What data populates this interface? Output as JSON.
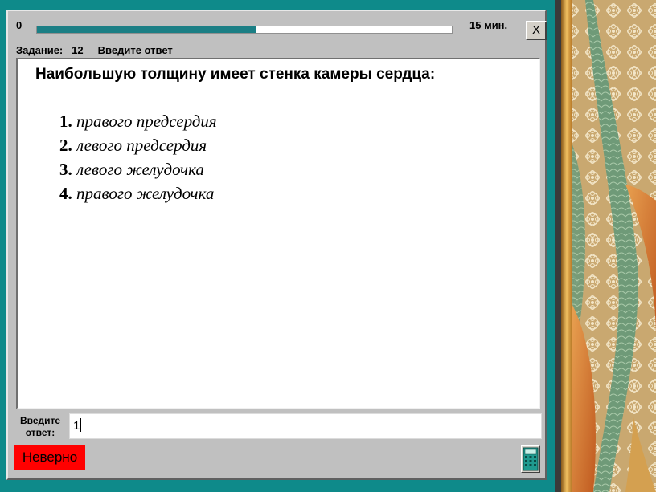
{
  "progress": {
    "start_label": "0",
    "fraction": 0.53
  },
  "timer": {
    "label": "15 мин."
  },
  "close_button": {
    "label": "X"
  },
  "task": {
    "label": "Задание:",
    "number": "12",
    "instruction": "Введите ответ"
  },
  "question": {
    "text": "Наибольшую толщину имеет стенка камеры сердца:",
    "options": [
      {
        "num": "1.",
        "text": "правого предсердия"
      },
      {
        "num": "2.",
        "text": "левого предсердия"
      },
      {
        "num": "3.",
        "text": "левого желудочка"
      },
      {
        "num": "4.",
        "text": "правого желудочка"
      }
    ]
  },
  "answer": {
    "label_line1": "Введите",
    "label_line2": "ответ:",
    "value": "1"
  },
  "status": {
    "text": "Неверно",
    "color": "#ff0000"
  },
  "icons": {
    "calculator": "calculator-icon",
    "close": "close-icon"
  },
  "colors": {
    "background": "#0e8a8a",
    "progress": "#1b7f85",
    "window": "#c0c0c0"
  }
}
